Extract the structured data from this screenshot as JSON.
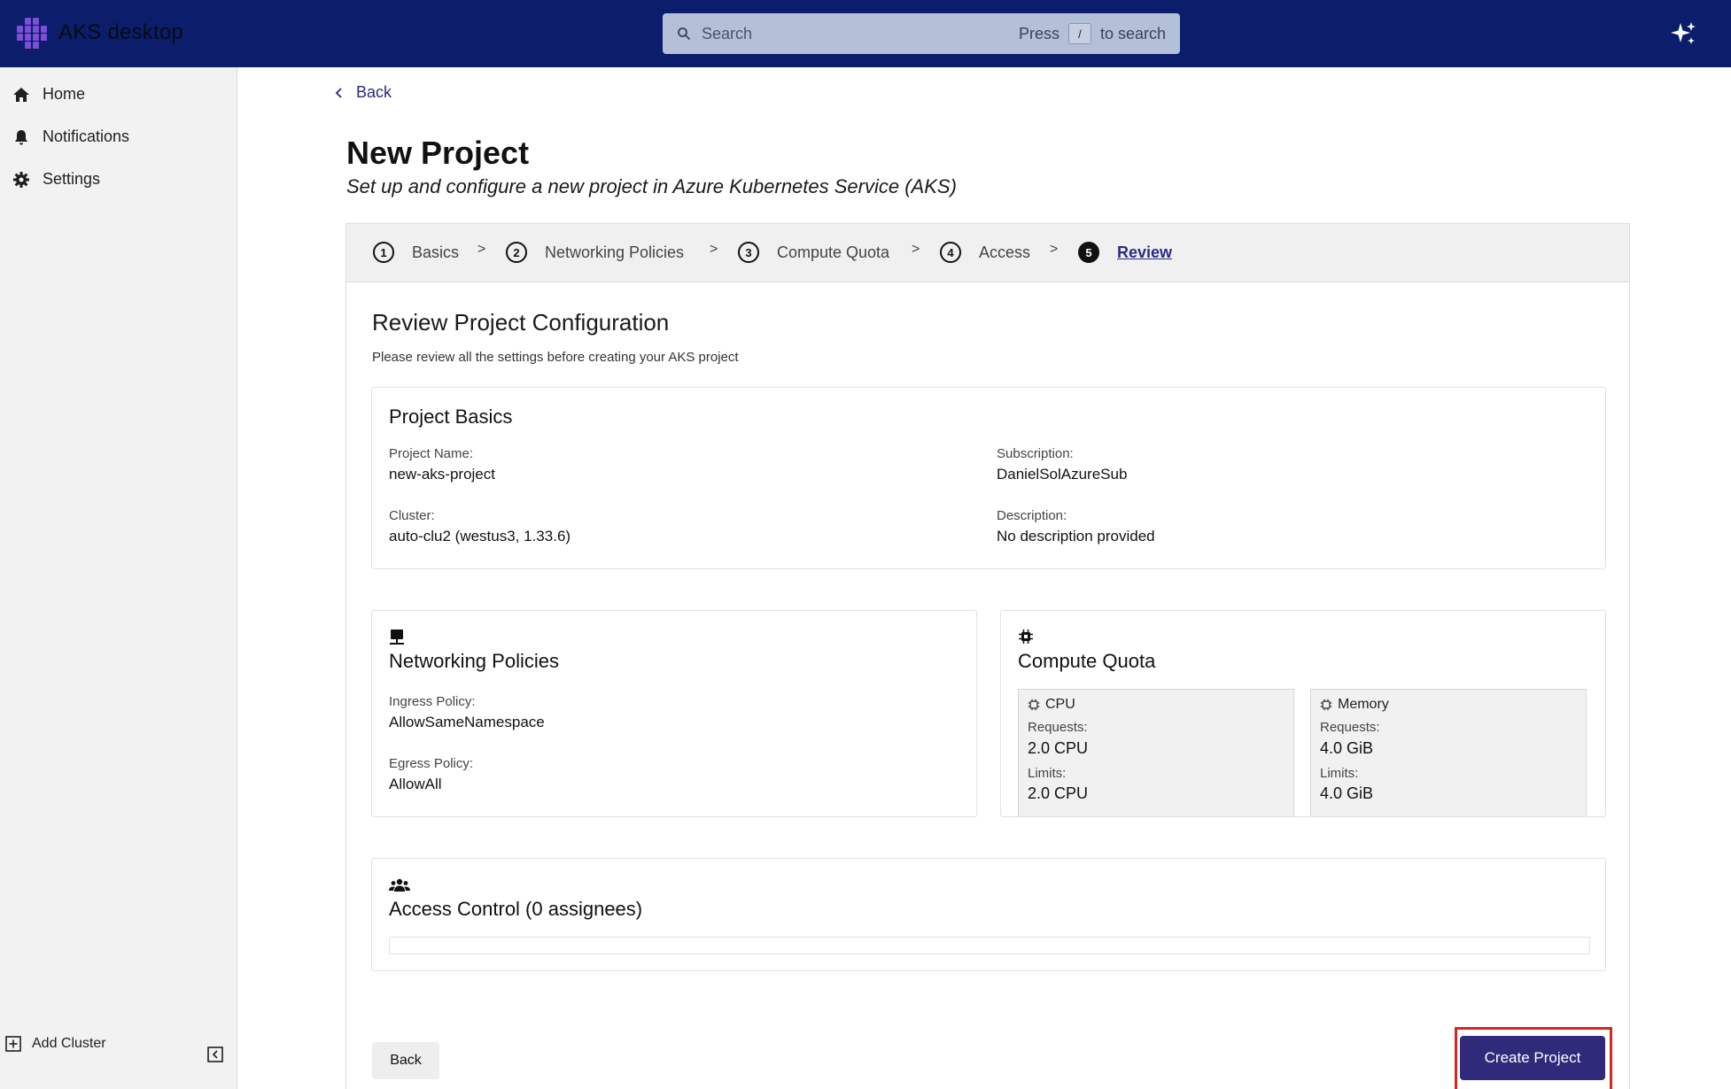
{
  "app": {
    "title": "AKS desktop"
  },
  "search": {
    "placeholder": "Search",
    "hint_prefix": "Press",
    "hint_key": "/",
    "hint_suffix": "to search"
  },
  "sidebar": {
    "items": [
      {
        "label": "Home",
        "icon": "home-icon"
      },
      {
        "label": "Notifications",
        "icon": "bell-icon"
      },
      {
        "label": "Settings",
        "icon": "gear-icon"
      }
    ],
    "add_cluster": "Add Cluster"
  },
  "page": {
    "back": "Back",
    "title": "New Project",
    "subtitle": "Set up and configure a new project in Azure Kubernetes Service (AKS)"
  },
  "stepper": {
    "steps": [
      {
        "num": "1",
        "label": "Basics"
      },
      {
        "num": "2",
        "label": "Networking Policies"
      },
      {
        "num": "3",
        "label": "Compute Quota"
      },
      {
        "num": "4",
        "label": "Access"
      },
      {
        "num": "5",
        "label": "Review"
      }
    ],
    "separator": ">",
    "active_step": 5
  },
  "review": {
    "title": "Review Project Configuration",
    "subtitle": "Please review all the settings before creating your AKS project",
    "basics": {
      "title": "Project Basics",
      "project_name_label": "Project Name:",
      "project_name": "new-aks-project",
      "subscription_label": "Subscription:",
      "subscription": "DanielSolAzureSub",
      "cluster_label": "Cluster:",
      "cluster": "auto-clu2 (westus3, 1.33.6)",
      "description_label": "Description:",
      "description": "No description provided"
    },
    "networking": {
      "title": "Networking Policies",
      "ingress_label": "Ingress Policy:",
      "ingress": "AllowSameNamespace",
      "egress_label": "Egress Policy:",
      "egress": "AllowAll"
    },
    "compute": {
      "title": "Compute Quota",
      "cpu": {
        "title": "CPU",
        "requests_label": "Requests:",
        "requests": "2.0 CPU",
        "limits_label": "Limits:",
        "limits": "2.0 CPU"
      },
      "memory": {
        "title": "Memory",
        "requests_label": "Requests:",
        "requests": "4.0 GiB",
        "limits_label": "Limits:",
        "limits": "4.0 GiB"
      }
    },
    "access": {
      "title": "Access Control (0 assignees)"
    }
  },
  "actions": {
    "back": "Back",
    "create": "Create Project"
  },
  "colors": {
    "topbar": "#0b1d6b",
    "primary_button": "#2f2a7a",
    "highlight": "#d8251e",
    "active_step": "#2d2a86"
  }
}
